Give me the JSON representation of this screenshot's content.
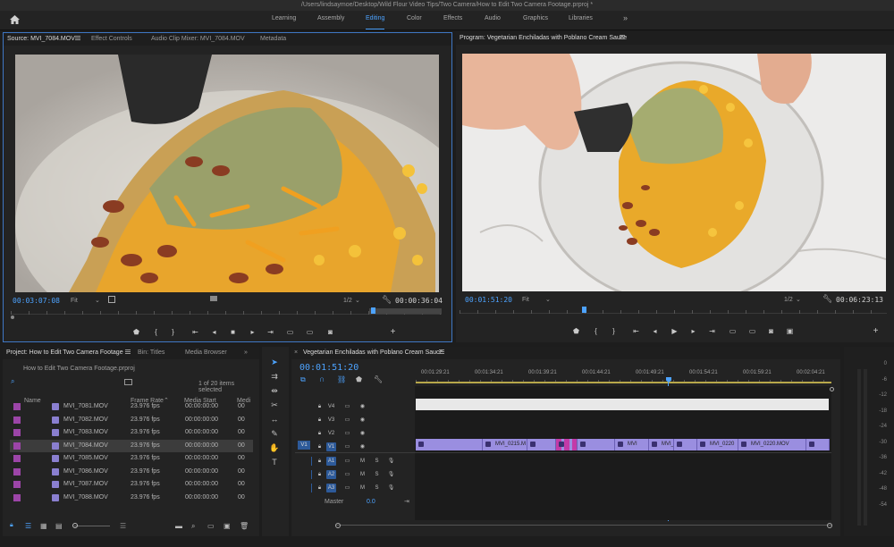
{
  "title_bar": "/Users/lindsaymoe/Desktop/Wild Flour Video Tips/Two Camera/How to Edit Two Camera Footage.prproj *",
  "workspaces": [
    "Learning",
    "Assembly",
    "Editing",
    "Color",
    "Effects",
    "Audio",
    "Graphics",
    "Libraries"
  ],
  "active_workspace": "Editing",
  "source_panel": {
    "tabs": [
      "Source: MVI_7084.MOV",
      "Effect Controls",
      "Audio Clip Mixer: MVI_7084.MOV",
      "Metadata"
    ],
    "timecode": "00:03:07:08",
    "fit": "Fit",
    "resolution": "1/2",
    "duration": "00:00:36:04",
    "playhead_fraction": 0.84
  },
  "program_panel": {
    "tab": "Program: Vegetarian Enchiladas with Poblano Cream Sauce",
    "timecode": "00:01:51:20",
    "fit": "Fit",
    "resolution": "1/2",
    "duration": "00:06:23:13",
    "playhead_fraction": 0.29
  },
  "project_panel": {
    "tabs": [
      "Project: How to Edit Two Camera Footage",
      "Bin: Titles",
      "Media Browser"
    ],
    "project_file": "How to Edit Two Camera Footage.prproj",
    "items_selected": "1 of 20 items selected",
    "columns": [
      "Name",
      "Frame Rate",
      "Media Start",
      "Medi"
    ],
    "rows": [
      {
        "name": "MVI_7081.MOV",
        "fps": "23.976 fps",
        "start": "00:00:00:00",
        "extra": "00"
      },
      {
        "name": "MVI_7082.MOV",
        "fps": "23.976 fps",
        "start": "00:00:00:00",
        "extra": "00"
      },
      {
        "name": "MVI_7083.MOV",
        "fps": "23.976 fps",
        "start": "00:00:00:00",
        "extra": "00"
      },
      {
        "name": "MVI_7084.MOV",
        "fps": "23.976 fps",
        "start": "00:00:00:00",
        "extra": "00",
        "selected": true
      },
      {
        "name": "MVI_7085.MOV",
        "fps": "23.976 fps",
        "start": "00:00:00:00",
        "extra": "00"
      },
      {
        "name": "MVI_7086.MOV",
        "fps": "23.976 fps",
        "start": "00:00:00:00",
        "extra": "00"
      },
      {
        "name": "MVI_7087.MOV",
        "fps": "23.976 fps",
        "start": "00:00:00:00",
        "extra": "00"
      },
      {
        "name": "MVI_7088.MOV",
        "fps": "23.976 fps",
        "start": "00:00:00:00",
        "extra": "00"
      }
    ]
  },
  "timeline": {
    "tab": "Vegetarian Enchiladas with Poblano Cream Sauce",
    "timecode": "00:01:51:20",
    "ruler": [
      "00:01:29:21",
      "00:01:34:21",
      "00:01:39:21",
      "00:01:44:21",
      "00:01:49:21",
      "00:01:54:21",
      "00:01:59:21",
      "00:02:04:21"
    ],
    "video_tracks": [
      "V4",
      "V3",
      "V2",
      "V1"
    ],
    "source_patch": "V1",
    "audio_tracks": [
      "A1",
      "A2",
      "A3"
    ],
    "audio_m": "M",
    "audio_s": "S",
    "master_label": "Master",
    "master_value": "0.0",
    "clips": [
      "MVI_0215.M",
      "MVI",
      "MVI_0",
      "MVI_0220",
      "MVI_0220.MOV"
    ]
  },
  "meter_labels": [
    "0",
    "-6",
    "-12",
    "-18",
    "-24",
    "-30",
    "-36",
    "-42",
    "-48",
    "-54"
  ],
  "colors": {
    "accent": "#4da3ff",
    "clip": "#9a8ee0",
    "label_swatch": "#9c45a8"
  }
}
